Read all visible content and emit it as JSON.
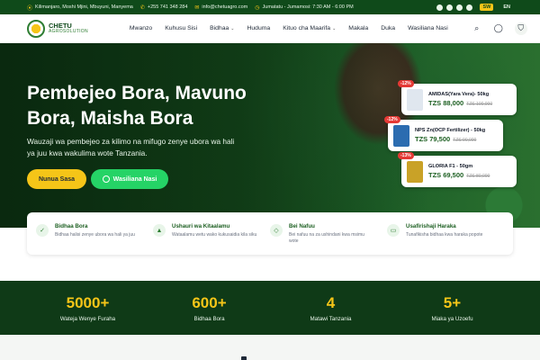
{
  "topbar": {
    "location": "Kilimanjaro, Moshi Mjini, Mbuyuni, Manyema",
    "phone": "+255 741 348 284",
    "email": "info@chetuagro.com",
    "hours": "Jumatatu - Jumamosi: 7:30 AM - 6:00 PM",
    "lang_sw": "SW",
    "lang_en": "EN"
  },
  "logo": {
    "name": "CHETU",
    "tagline": "AGROSOLUTION"
  },
  "nav": {
    "items": [
      "Mwanzo",
      "Kuhusu Sisi",
      "Bidhaa",
      "Huduma",
      "Kituo cha Maarifa",
      "Makala",
      "Duka",
      "Wasiliana Nasi"
    ]
  },
  "hero": {
    "title": "Pembejeo Bora, Mavuno Bora, Maisha Bora",
    "subtitle": "Wauzaji wa pembejeo za kilimo na mifugo zenye ubora wa hali ya juu kwa wakulima wote Tanzania.",
    "cta_primary": "Nunua Sasa",
    "cta_whatsapp": "Wasiliana Nasi"
  },
  "products": [
    {
      "discount": "-12%",
      "name": "AMIDAS(Yara Vera)- 50kg",
      "price": "TZS 88,000",
      "old_price": "TZS 100,000",
      "thumb_color": "#e0e7ef"
    },
    {
      "discount": "-12%",
      "name": "NPS Zn(OCP Fertilizer) - 50kg",
      "price": "TZS 79,500",
      "old_price": "TZS 90,000",
      "thumb_color": "#2b6cb0"
    },
    {
      "discount": "-13%",
      "name": "GLORIA F1 - 50gm",
      "price": "TZS 69,500",
      "old_price": "TZS 80,000",
      "thumb_color": "#c9a227"
    }
  ],
  "features": [
    {
      "title": "Bidhaa Bora",
      "desc": "Bidhaa halisi zenye ubora wa hali ya juu",
      "icon": "check-circle-icon",
      "glyph": "✓"
    },
    {
      "title": "Ushauri wa Kitaalamu",
      "desc": "Wataalamu wetu wako kukusaidia kila siku",
      "icon": "graduation-cap-icon",
      "glyph": "🎓"
    },
    {
      "title": "Bei Nafuu",
      "desc": "Bei nafuu na za ushindani kwa msimu wote",
      "icon": "tag-icon",
      "glyph": "◇"
    },
    {
      "title": "Usafirishaji Haraka",
      "desc": "Tunafikisha bidhaa kwa haraka popote",
      "icon": "truck-icon",
      "glyph": "⛟"
    }
  ],
  "stats": [
    {
      "value": "5000+",
      "label": "Wateja Wenye Furaha"
    },
    {
      "value": "600+",
      "label": "Bidhaa Bora"
    },
    {
      "value": "4",
      "label": "Matawi Tanzania"
    },
    {
      "value": "5+",
      "label": "Miaka ya Uzoefu"
    }
  ],
  "colors": {
    "primary_green": "#0f4a1a",
    "accent_yellow": "#f5c518",
    "whatsapp": "#25d366",
    "discount_red": "#e53935"
  }
}
